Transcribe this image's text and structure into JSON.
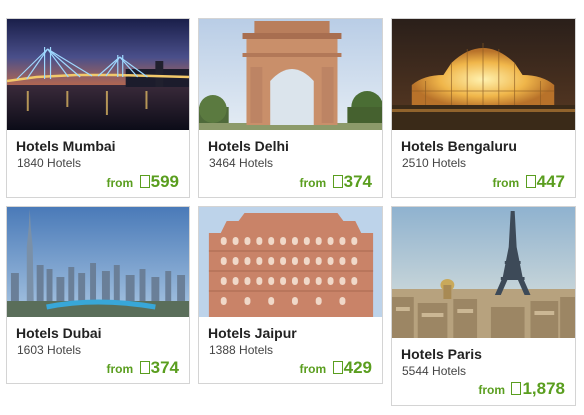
{
  "price_prefix": "from",
  "colors": {
    "price": "#5a9e1f",
    "border": "#d4d4d4"
  },
  "cards": [
    {
      "title": "Hotels Mumbai",
      "count": "1840 Hotels",
      "price": "599"
    },
    {
      "title": "Hotels Delhi",
      "count": "3464 Hotels",
      "price": "374"
    },
    {
      "title": "Hotels Bengaluru",
      "count": "2510 Hotels",
      "price": "447"
    },
    {
      "title": "Hotels Dubai",
      "count": "1603 Hotels",
      "price": "374"
    },
    {
      "title": "Hotels Jaipur",
      "count": "1388 Hotels",
      "price": "429"
    },
    {
      "title": "Hotels Paris",
      "count": "5544 Hotels",
      "price": "1,878"
    }
  ]
}
